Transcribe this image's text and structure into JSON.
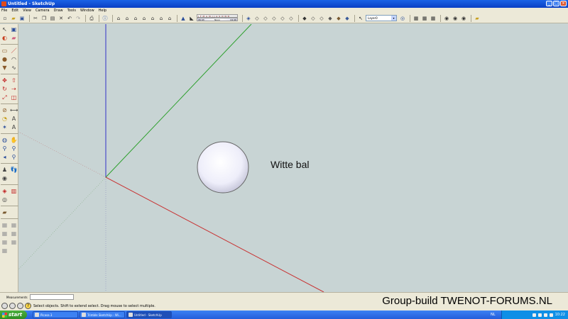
{
  "window": {
    "title": "Untitled - SketchUp"
  },
  "menu": [
    "File",
    "Edit",
    "View",
    "Camera",
    "Draw",
    "Tools",
    "Window",
    "Help"
  ],
  "toolbar": {
    "shadow_months": "J F M A M J J A S O N D",
    "shadow_time_start": "06:43",
    "shadow_time_mid": "Noon",
    "shadow_time_end": "04:46",
    "layer_value": "Layer0"
  },
  "viewport": {
    "label": "Witte bal",
    "axis_colors": {
      "red": "#c83232",
      "green": "#2ea02e",
      "blue": "#3232c8"
    }
  },
  "measurements": {
    "label": "Measurements",
    "value": ""
  },
  "status": {
    "text": "Select objects. Shift to extend select. Drag mouse to select multiple."
  },
  "watermark": "Group-build TWENOT-FORUMS.NL",
  "taskbar": {
    "start": "start",
    "tasks": [
      "Picasa 3",
      "Trimble SketchUp - Wi...",
      "Untitled - SketchUp"
    ],
    "lang": "NL",
    "clock": "10:22"
  }
}
